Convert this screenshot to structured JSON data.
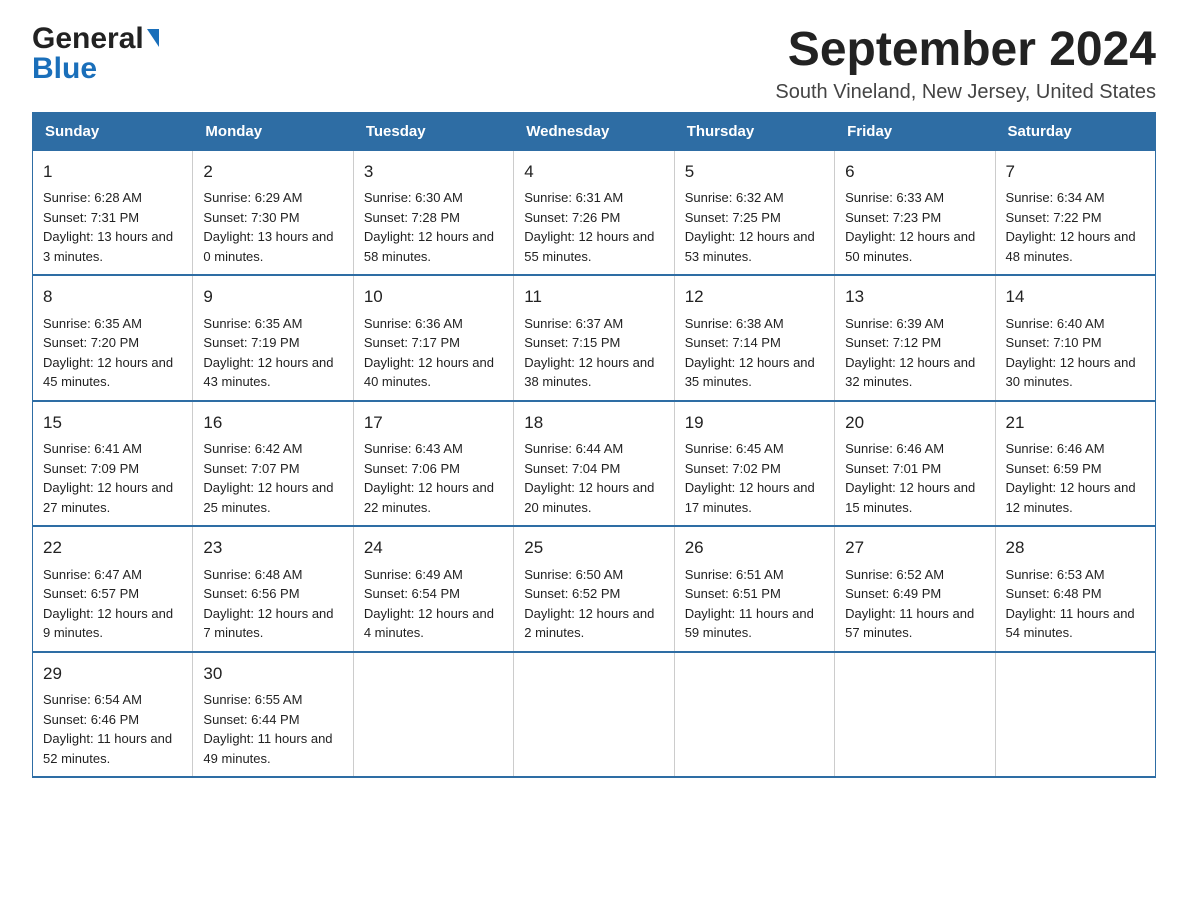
{
  "logo": {
    "line1": "General",
    "line2": "Blue"
  },
  "title": "September 2024",
  "subtitle": "South Vineland, New Jersey, United States",
  "days_of_week": [
    "Sunday",
    "Monday",
    "Tuesday",
    "Wednesday",
    "Thursday",
    "Friday",
    "Saturday"
  ],
  "weeks": [
    [
      {
        "day": "1",
        "sunrise": "Sunrise: 6:28 AM",
        "sunset": "Sunset: 7:31 PM",
        "daylight": "Daylight: 13 hours and 3 minutes."
      },
      {
        "day": "2",
        "sunrise": "Sunrise: 6:29 AM",
        "sunset": "Sunset: 7:30 PM",
        "daylight": "Daylight: 13 hours and 0 minutes."
      },
      {
        "day": "3",
        "sunrise": "Sunrise: 6:30 AM",
        "sunset": "Sunset: 7:28 PM",
        "daylight": "Daylight: 12 hours and 58 minutes."
      },
      {
        "day": "4",
        "sunrise": "Sunrise: 6:31 AM",
        "sunset": "Sunset: 7:26 PM",
        "daylight": "Daylight: 12 hours and 55 minutes."
      },
      {
        "day": "5",
        "sunrise": "Sunrise: 6:32 AM",
        "sunset": "Sunset: 7:25 PM",
        "daylight": "Daylight: 12 hours and 53 minutes."
      },
      {
        "day": "6",
        "sunrise": "Sunrise: 6:33 AM",
        "sunset": "Sunset: 7:23 PM",
        "daylight": "Daylight: 12 hours and 50 minutes."
      },
      {
        "day": "7",
        "sunrise": "Sunrise: 6:34 AM",
        "sunset": "Sunset: 7:22 PM",
        "daylight": "Daylight: 12 hours and 48 minutes."
      }
    ],
    [
      {
        "day": "8",
        "sunrise": "Sunrise: 6:35 AM",
        "sunset": "Sunset: 7:20 PM",
        "daylight": "Daylight: 12 hours and 45 minutes."
      },
      {
        "day": "9",
        "sunrise": "Sunrise: 6:35 AM",
        "sunset": "Sunset: 7:19 PM",
        "daylight": "Daylight: 12 hours and 43 minutes."
      },
      {
        "day": "10",
        "sunrise": "Sunrise: 6:36 AM",
        "sunset": "Sunset: 7:17 PM",
        "daylight": "Daylight: 12 hours and 40 minutes."
      },
      {
        "day": "11",
        "sunrise": "Sunrise: 6:37 AM",
        "sunset": "Sunset: 7:15 PM",
        "daylight": "Daylight: 12 hours and 38 minutes."
      },
      {
        "day": "12",
        "sunrise": "Sunrise: 6:38 AM",
        "sunset": "Sunset: 7:14 PM",
        "daylight": "Daylight: 12 hours and 35 minutes."
      },
      {
        "day": "13",
        "sunrise": "Sunrise: 6:39 AM",
        "sunset": "Sunset: 7:12 PM",
        "daylight": "Daylight: 12 hours and 32 minutes."
      },
      {
        "day": "14",
        "sunrise": "Sunrise: 6:40 AM",
        "sunset": "Sunset: 7:10 PM",
        "daylight": "Daylight: 12 hours and 30 minutes."
      }
    ],
    [
      {
        "day": "15",
        "sunrise": "Sunrise: 6:41 AM",
        "sunset": "Sunset: 7:09 PM",
        "daylight": "Daylight: 12 hours and 27 minutes."
      },
      {
        "day": "16",
        "sunrise": "Sunrise: 6:42 AM",
        "sunset": "Sunset: 7:07 PM",
        "daylight": "Daylight: 12 hours and 25 minutes."
      },
      {
        "day": "17",
        "sunrise": "Sunrise: 6:43 AM",
        "sunset": "Sunset: 7:06 PM",
        "daylight": "Daylight: 12 hours and 22 minutes."
      },
      {
        "day": "18",
        "sunrise": "Sunrise: 6:44 AM",
        "sunset": "Sunset: 7:04 PM",
        "daylight": "Daylight: 12 hours and 20 minutes."
      },
      {
        "day": "19",
        "sunrise": "Sunrise: 6:45 AM",
        "sunset": "Sunset: 7:02 PM",
        "daylight": "Daylight: 12 hours and 17 minutes."
      },
      {
        "day": "20",
        "sunrise": "Sunrise: 6:46 AM",
        "sunset": "Sunset: 7:01 PM",
        "daylight": "Daylight: 12 hours and 15 minutes."
      },
      {
        "day": "21",
        "sunrise": "Sunrise: 6:46 AM",
        "sunset": "Sunset: 6:59 PM",
        "daylight": "Daylight: 12 hours and 12 minutes."
      }
    ],
    [
      {
        "day": "22",
        "sunrise": "Sunrise: 6:47 AM",
        "sunset": "Sunset: 6:57 PM",
        "daylight": "Daylight: 12 hours and 9 minutes."
      },
      {
        "day": "23",
        "sunrise": "Sunrise: 6:48 AM",
        "sunset": "Sunset: 6:56 PM",
        "daylight": "Daylight: 12 hours and 7 minutes."
      },
      {
        "day": "24",
        "sunrise": "Sunrise: 6:49 AM",
        "sunset": "Sunset: 6:54 PM",
        "daylight": "Daylight: 12 hours and 4 minutes."
      },
      {
        "day": "25",
        "sunrise": "Sunrise: 6:50 AM",
        "sunset": "Sunset: 6:52 PM",
        "daylight": "Daylight: 12 hours and 2 minutes."
      },
      {
        "day": "26",
        "sunrise": "Sunrise: 6:51 AM",
        "sunset": "Sunset: 6:51 PM",
        "daylight": "Daylight: 11 hours and 59 minutes."
      },
      {
        "day": "27",
        "sunrise": "Sunrise: 6:52 AM",
        "sunset": "Sunset: 6:49 PM",
        "daylight": "Daylight: 11 hours and 57 minutes."
      },
      {
        "day": "28",
        "sunrise": "Sunrise: 6:53 AM",
        "sunset": "Sunset: 6:48 PM",
        "daylight": "Daylight: 11 hours and 54 minutes."
      }
    ],
    [
      {
        "day": "29",
        "sunrise": "Sunrise: 6:54 AM",
        "sunset": "Sunset: 6:46 PM",
        "daylight": "Daylight: 11 hours and 52 minutes."
      },
      {
        "day": "30",
        "sunrise": "Sunrise: 6:55 AM",
        "sunset": "Sunset: 6:44 PM",
        "daylight": "Daylight: 11 hours and 49 minutes."
      },
      null,
      null,
      null,
      null,
      null
    ]
  ]
}
